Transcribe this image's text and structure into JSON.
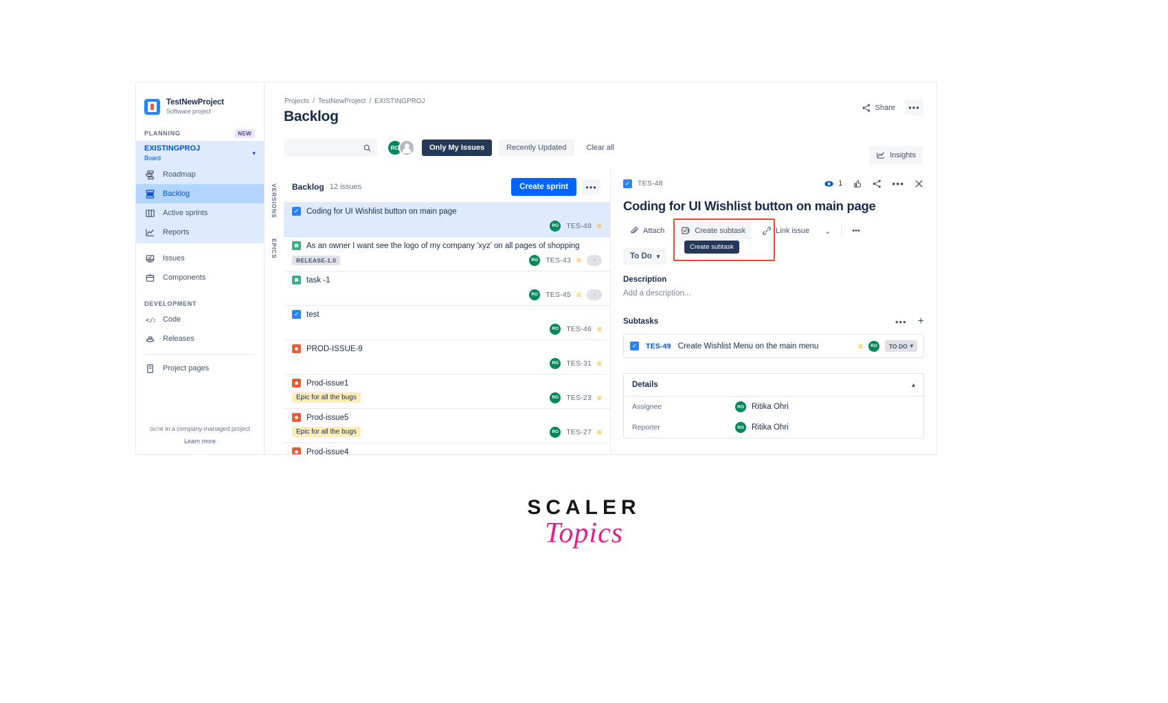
{
  "sidebar": {
    "project_name": "TestNewProject",
    "project_type": "Software project",
    "planning_label": "PLANNING",
    "new_badge": "NEW",
    "board_key": "EXISTINGPROJ",
    "board_sub": "Board",
    "planning_items": [
      {
        "label": "Roadmap",
        "icon": "roadmap-icon",
        "active": false
      },
      {
        "label": "Backlog",
        "icon": "backlog-icon",
        "active": true
      },
      {
        "label": "Active sprints",
        "icon": "board-columns-icon",
        "active": false
      },
      {
        "label": "Reports",
        "icon": "reports-chart-icon",
        "active": false
      }
    ],
    "other_items": [
      {
        "label": "Issues",
        "icon": "issues-icon"
      },
      {
        "label": "Components",
        "icon": "components-icon"
      }
    ],
    "development_label": "DEVELOPMENT",
    "development_items": [
      {
        "label": "Code",
        "icon": "code-icon"
      },
      {
        "label": "Releases",
        "icon": "releases-ship-icon"
      }
    ],
    "project_pages": "Project pages",
    "footnote": "ou're in a company-managed project",
    "learn_more": "Learn more"
  },
  "header": {
    "breadcrumbs": [
      "Projects",
      "TestNewProject",
      "EXISTINGPROJ"
    ],
    "title": "Backlog",
    "share_label": "Share",
    "more_label": "•••",
    "insights_label": "Insights"
  },
  "filters": {
    "search_placeholder": "",
    "search_value": "",
    "avatar_initials": "RO",
    "only_my_issues": "Only My Issues",
    "recently_updated": "Recently Updated",
    "clear_all": "Clear all"
  },
  "rail": {
    "versions": "VERSIONS",
    "epics": "EPICS"
  },
  "backlog": {
    "title": "Backlog",
    "count": "12 issues",
    "create_sprint": "Create sprint",
    "more": "•••",
    "rows": [
      {
        "type": "task",
        "title": "Coding for UI Wishlist button on main page",
        "key": "TES-48",
        "avatar": "RO",
        "priority": "medium",
        "chip": "",
        "chip_type": "",
        "estimate": "",
        "selected": true
      },
      {
        "type": "story",
        "title": "As an owner I want see the logo of my company 'xyz' on all pages of shopping",
        "key": "TES-43",
        "avatar": "RO",
        "priority": "medium",
        "chip": "RELEASE-1.0",
        "chip_type": "grey",
        "estimate": "-",
        "selected": false
      },
      {
        "type": "story",
        "title": "task -1",
        "key": "TES-45",
        "avatar": "RO",
        "priority": "medium",
        "chip": "",
        "chip_type": "",
        "estimate": "-",
        "selected": false
      },
      {
        "type": "task",
        "title": "test",
        "key": "TES-46",
        "avatar": "RO",
        "priority": "medium",
        "chip": "",
        "chip_type": "",
        "estimate": "",
        "selected": false
      },
      {
        "type": "bug",
        "title": "PROD-ISSUE-9",
        "key": "TES-31",
        "avatar": "RO",
        "priority": "medium",
        "chip": "",
        "chip_type": "",
        "estimate": "",
        "selected": false
      },
      {
        "type": "bug",
        "title": "Prod-issue1",
        "key": "TES-23",
        "avatar": "RO",
        "priority": "medium",
        "chip": "Epic for all the bugs",
        "chip_type": "yellow",
        "estimate": "",
        "selected": false
      },
      {
        "type": "bug",
        "title": "Prod-issue5",
        "key": "TES-27",
        "avatar": "RO",
        "priority": "medium",
        "chip": "Epic for all the bugs",
        "chip_type": "yellow",
        "estimate": "",
        "selected": false
      },
      {
        "type": "bug",
        "title": "Prod-issue4",
        "key": "",
        "avatar": "",
        "priority": "",
        "chip": "",
        "chip_type": "",
        "estimate": "",
        "selected": false
      }
    ]
  },
  "detail": {
    "key": "TES-48",
    "watch_count": "1",
    "title": "Coding for UI Wishlist button on main page",
    "actions": {
      "attach": "Attach",
      "create_subtask": "Create subtask",
      "link_issue": "Link issue",
      "chevron": "⌄",
      "more": "•••"
    },
    "tooltip": "Create subtask",
    "status": "To Do",
    "description_label": "Description",
    "description_placeholder": "Add a description...",
    "subtasks_label": "Subtasks",
    "subtasks": [
      {
        "key": "TES-49",
        "title": "Create Wishlist Menu on the main menu",
        "priority": "medium",
        "avatar": "RO",
        "status": "TO DO"
      }
    ],
    "details_label": "Details",
    "details_rows": [
      {
        "label": "Assignee",
        "avatar": "RO",
        "value": "Ritika Ohri"
      },
      {
        "label": "Reporter",
        "avatar": "RO",
        "value": "Ritika Ohri"
      }
    ]
  },
  "logo": {
    "main": "SCALER",
    "sub": "Topics"
  },
  "colors": {
    "accent_blue": "#0065ff",
    "selected_row": "#deebff",
    "highlight_red": "#e8462a",
    "green_avatar": "#00875a",
    "priority_amber": "#ffab00",
    "brand_pink": "#e0218a"
  }
}
